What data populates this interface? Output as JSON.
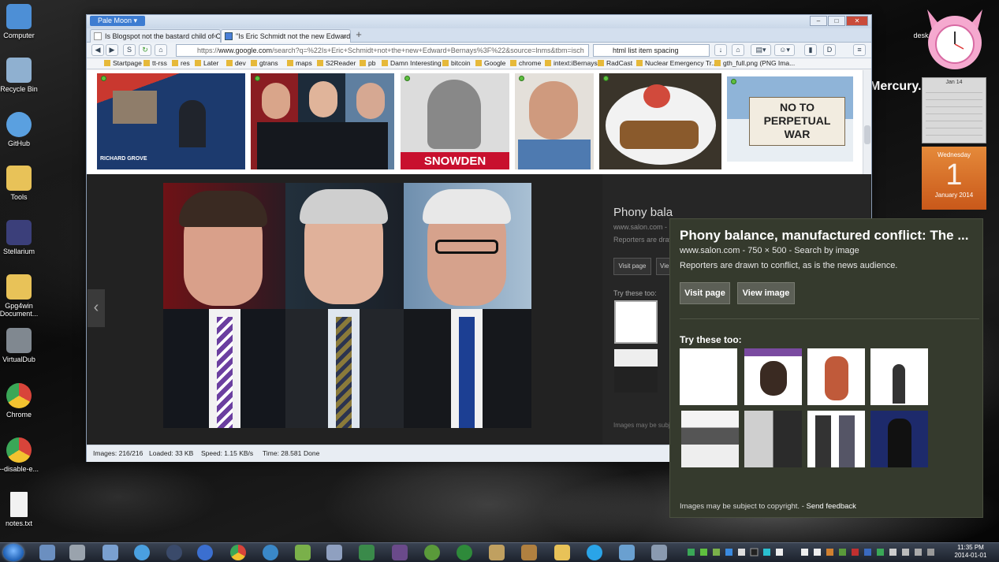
{
  "desktop": {
    "icons": [
      {
        "label": "Computer",
        "color": "#4d8fd6"
      },
      {
        "label": "Recycle Bin",
        "color": "#8fb0d0"
      },
      {
        "label": "GitHub",
        "color": "#5aa0e0"
      },
      {
        "label": "Tools",
        "color": "#e8c258"
      },
      {
        "label": "Stellarium",
        "color": "#3b3f7a"
      },
      {
        "label": "Gpg4win Document...",
        "color": "#e8c258"
      },
      {
        "label": "VirtualDub",
        "color": "#808890"
      },
      {
        "label": "Chrome",
        "color": "#d8443a"
      },
      {
        "label": "--disable-e...",
        "color": "#d8443a"
      },
      {
        "label": "notes.txt",
        "color": "#f2f2f2"
      }
    ],
    "right_icon_label": "desk",
    "mercury_label": "Mercury.",
    "calendar": {
      "month": "Jan 14",
      "day_name": "Wednesday",
      "day": "1",
      "month_year": "January 2014"
    }
  },
  "browser": {
    "app_button": "Pale Moon",
    "tabs": [
      {
        "label": "Is Blogspot not the bastard child of C..."
      },
      {
        "label": "\"Is Eric Schmidt not the new Edward ..."
      }
    ],
    "url": {
      "prefix": "https://",
      "host": "www.google.com",
      "rest": "/search?q=%22Is+Eric+Schmidt+not+the+new+Edward+Bernays%3F%22&source=lnms&tbm=isch"
    },
    "search_box": "html list item spacing",
    "bookmarks": [
      "Startpage",
      "tt-rss",
      "res",
      "Later",
      "dev",
      "gtrans",
      "maps",
      "S2Reader",
      "pb",
      "Damn Interesting",
      "bitcoin",
      "Google",
      "chrome",
      "intext:iBernays",
      "RadCast",
      "Nuclear Emergency Tr...",
      "gth_full.png (PNG Ima..."
    ],
    "thumbnails": [
      {
        "caption": "RICHARD GROVE",
        "color": "#1c3a6e"
      },
      {
        "caption": "",
        "color": "#2b2b2b"
      },
      {
        "caption": "SNOWDEN",
        "color": "#c8102e"
      },
      {
        "caption": "",
        "color": "#4e7ab0"
      },
      {
        "caption": "",
        "color": "#6e5a3a"
      },
      {
        "caption": "NO TO PERPETUAL WAR",
        "color": "#6b8fb5"
      }
    ],
    "preview": {
      "title_partial": "Phony bala",
      "src_partial": "www.salon.com - 7",
      "desc_partial": "Reporters are draw",
      "visit_partial": "Visit page",
      "view_partial": "Vie",
      "try_partial": "Try these too:",
      "copy_partial": "Images may be subject"
    },
    "status": {
      "images": "Images: 216/216",
      "loaded": "Loaded: 33 KB",
      "speed": "Speed: 1.15 KB/s",
      "time": "Time: 28.581",
      "state": "Done"
    }
  },
  "panel": {
    "title": "Phony balance, manufactured conflict: The ...",
    "source": "www.salon.com - 750 × 500 - Search by image",
    "description": "Reporters are drawn to conflict, as is the news audience.",
    "visit_button": "Visit page",
    "view_button": "View image",
    "try_label": "Try these too:",
    "copyright": "Images may be subject to copyright.",
    "feedback": "Send feedback"
  },
  "taskbar": {
    "time": "11:35 PM",
    "date": "2014-01-01"
  }
}
